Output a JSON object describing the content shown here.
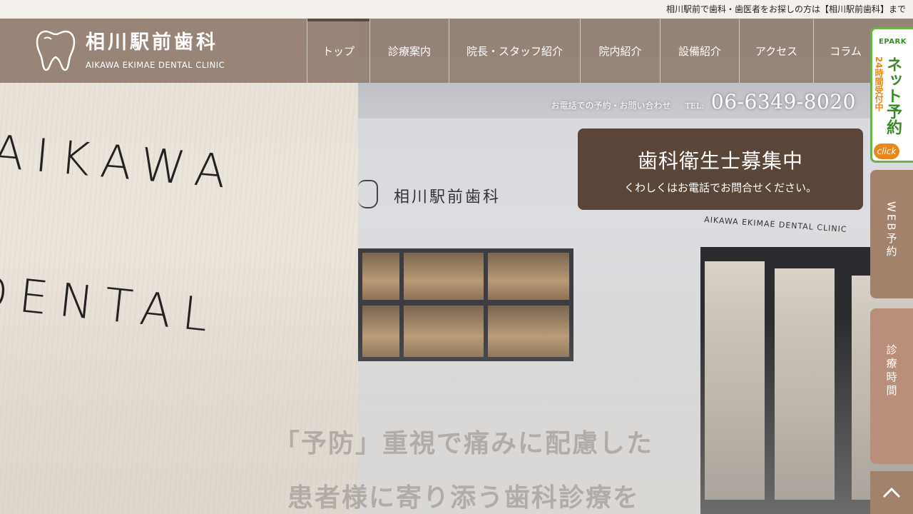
{
  "topbar": {
    "text": "相川駅前で歯科・歯医者をお探しの方は【相川駅前歯科】まで"
  },
  "logo": {
    "jp": "相川駅前歯科",
    "en": "AIKAWA EKIMAE DENTAL CLINIC",
    "icon": "tooth-icon"
  },
  "nav": {
    "items": [
      {
        "label": "トップ",
        "active": true
      },
      {
        "label": "診療案内",
        "active": false
      },
      {
        "label": "院長・スタッフ紹介",
        "active": false
      },
      {
        "label": "院内紹介",
        "active": false
      },
      {
        "label": "設備紹介",
        "active": false
      },
      {
        "label": "アクセス",
        "active": false
      },
      {
        "label": "コラム",
        "active": false
      }
    ]
  },
  "contact": {
    "label": "お電話での予約・お問い合わせ",
    "tel_prefix": "TEL:",
    "number": "06-6349-8020"
  },
  "recruit": {
    "title": "歯科衛生士募集中",
    "subtitle": "くわしくはお電話でお問合せください。"
  },
  "epark": {
    "brand": "EPARK",
    "hours": "24時間受付中",
    "label": "ネット予約",
    "click": "click"
  },
  "side": {
    "web_reserve": "WEB予約",
    "hours": "診療時間",
    "pagetop_icon": "chevron-up-icon"
  },
  "hero": {
    "sign_line1": "AIKAWA",
    "sign_line2": "DENTAL",
    "wall_logo": "相川駅前歯科",
    "wall_sub": "AIKAWA EKIMAE DENTAL CLINIC",
    "catch_line1": "「予防」重視で痛みに配慮した",
    "catch_line2": "患者様に寄り添う歯科診療を"
  },
  "colors": {
    "header_bg": "#8c786a",
    "accent_dark": "#5a4638",
    "epark_green": "#6fb24b",
    "epark_orange": "#e7871e",
    "side_tab": "#a3826c"
  }
}
